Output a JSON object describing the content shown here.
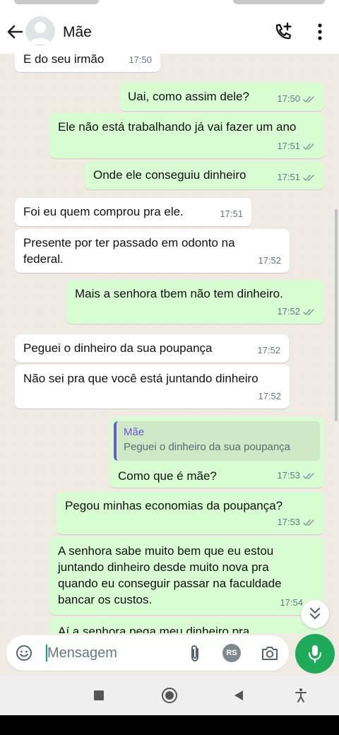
{
  "header": {
    "contact_name": "Mãe"
  },
  "messages": [
    {
      "dir": "in",
      "text": "É do seu irmão",
      "time": "17:50"
    },
    {
      "dir": "out",
      "text": "Uai, como assim dele?",
      "time": "17:50"
    },
    {
      "dir": "out",
      "text": "Ele não está trabalhando já vai fazer um ano",
      "time": "17:51"
    },
    {
      "dir": "out",
      "text": "Onde ele conseguiu dinheiro",
      "time": "17:51"
    },
    {
      "dir": "in",
      "text": "Foi eu quem comprou pra ele.",
      "time": "17:51"
    },
    {
      "dir": "in",
      "text": "Presente por ter passado em odonto na federal.",
      "time": "17:52"
    },
    {
      "dir": "out",
      "text": "Mais a senhora tbem não tem dinheiro.",
      "time": "17:52"
    },
    {
      "dir": "in",
      "text": "Peguei o dinheiro da sua poupança",
      "time": "17:52"
    },
    {
      "dir": "in",
      "text": "Não sei pra que você está juntando dinheiro",
      "time": "17:52"
    },
    {
      "dir": "out",
      "text": "Como que é mãe?",
      "time": "17:53",
      "quote_name": "Mãe",
      "quote_text": "Peguei o dinheiro da sua poupança"
    },
    {
      "dir": "out",
      "text": "Pegou minhas economias da poupança?",
      "time": "17:53"
    },
    {
      "dir": "out",
      "text": "A senhora sabe muito bem que eu estou juntando dinheiro desde muito nova pra quando eu conseguir passar na faculdade bancar os custos.",
      "time": "17:54"
    },
    {
      "dir": "out",
      "text": "Aí a senhora pega meu dinheiro pra",
      "time": ""
    }
  ],
  "input": {
    "placeholder": "Mensagem",
    "rs_badge": "RS"
  },
  "icons": {
    "back": "arrow-left-icon",
    "add_call": "phone-plus-icon",
    "menu": "more-vert-icon",
    "emoji": "emoji-icon",
    "attach": "paperclip-icon",
    "camera": "camera-icon",
    "mic": "mic-icon",
    "read": "double-check-icon",
    "scroll_down": "chevron-double-down-icon"
  },
  "colors": {
    "outgoing_bubble": "#d9fdd3",
    "incoming_bubble": "#ffffff",
    "accent_green": "#1faa59",
    "quote_accent": "#6e57d4",
    "chat_background": "#efeae2"
  }
}
